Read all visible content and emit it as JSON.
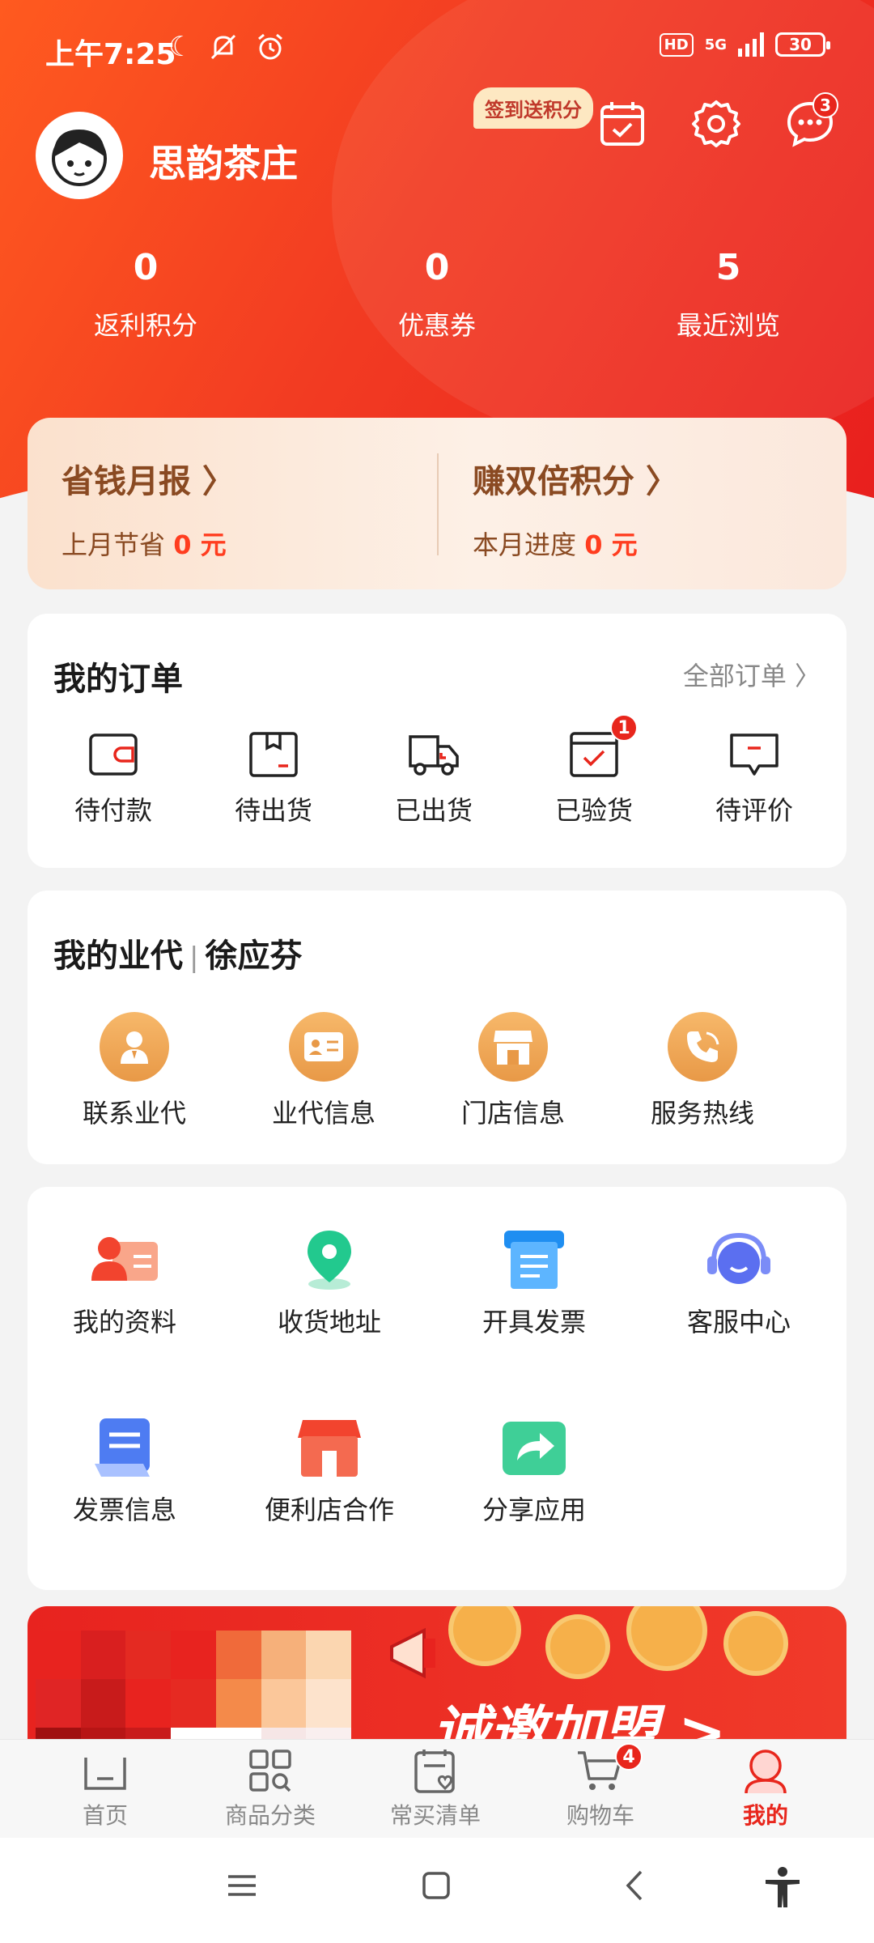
{
  "status": {
    "time": "上午7:25",
    "hd": "HD",
    "network": "5G",
    "battery": "30"
  },
  "profile": {
    "shop_name": "思韵茶庄",
    "checkin_tag": "签到送积分",
    "message_badge": "3"
  },
  "stats": [
    {
      "value": "0",
      "label": "返利积分"
    },
    {
      "value": "0",
      "label": "优惠券"
    },
    {
      "value": "5",
      "label": "最近浏览"
    }
  ],
  "savings": {
    "left": {
      "title": "省钱月报 〉",
      "prefix": "上月节省 ",
      "value": "0 元"
    },
    "right": {
      "title": "赚双倍积分 〉",
      "prefix": "本月进度 ",
      "value": "0 元"
    }
  },
  "orders": {
    "title": "我的订单",
    "all": "全部订单 〉",
    "items": [
      {
        "label": "待付款",
        "icon": "wallet-icon"
      },
      {
        "label": "待出货",
        "icon": "box-icon"
      },
      {
        "label": "已出货",
        "icon": "truck-icon"
      },
      {
        "label": "已验货",
        "icon": "checked-box-icon",
        "badge": "1"
      },
      {
        "label": "待评价",
        "icon": "comment-icon"
      }
    ]
  },
  "agent": {
    "title": "我的业代",
    "name": "徐应芬",
    "items": [
      {
        "label": "联系业代",
        "icon": "person-icon"
      },
      {
        "label": "业代信息",
        "icon": "id-card-icon"
      },
      {
        "label": "门店信息",
        "icon": "store-icon"
      },
      {
        "label": "服务热线",
        "icon": "phone-icon"
      }
    ]
  },
  "services": [
    {
      "label": "我的资料",
      "icon": "profile-card-icon"
    },
    {
      "label": "收货地址",
      "icon": "location-pin-icon"
    },
    {
      "label": "开具发票",
      "icon": "invoice-printer-icon"
    },
    {
      "label": "客服中心",
      "icon": "headset-icon"
    },
    {
      "label": "发票信息",
      "icon": "document-icon"
    },
    {
      "label": "便利店合作",
      "icon": "shop-icon"
    },
    {
      "label": "分享应用",
      "icon": "share-icon"
    }
  ],
  "banner": {
    "text": "诚邀加盟 >"
  },
  "tabs": [
    {
      "label": "首页",
      "icon": "home-icon"
    },
    {
      "label": "商品分类",
      "icon": "category-icon"
    },
    {
      "label": "常买清单",
      "icon": "list-icon"
    },
    {
      "label": "购物车",
      "icon": "cart-icon",
      "badge": "4"
    },
    {
      "label": "我的",
      "icon": "user-icon",
      "active": true
    }
  ],
  "colors": {
    "brand_red": "#e8261c",
    "brand_orange": "#ff5a1f",
    "gold": "#e89947"
  }
}
